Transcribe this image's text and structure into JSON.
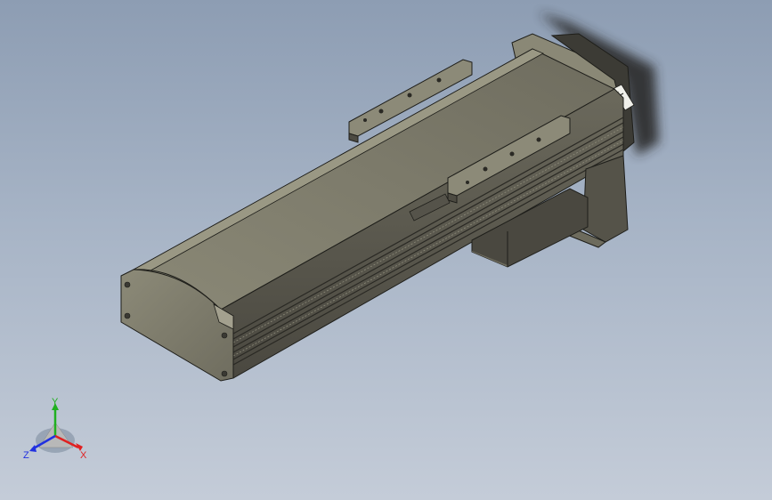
{
  "viewport": {
    "background_top": "#8d9db3",
    "background_bottom": "#c4ccd8"
  },
  "model": {
    "body_color": "#7f7c6d",
    "body_dark": "#4d4b42",
    "body_light": "#a3a08e",
    "outline_color": "#1e1e1a"
  },
  "triad": {
    "x_label": "X",
    "y_label": "Y",
    "z_label": "Z",
    "x_color": "#e02020",
    "y_color": "#20b020",
    "z_color": "#2030e0"
  }
}
